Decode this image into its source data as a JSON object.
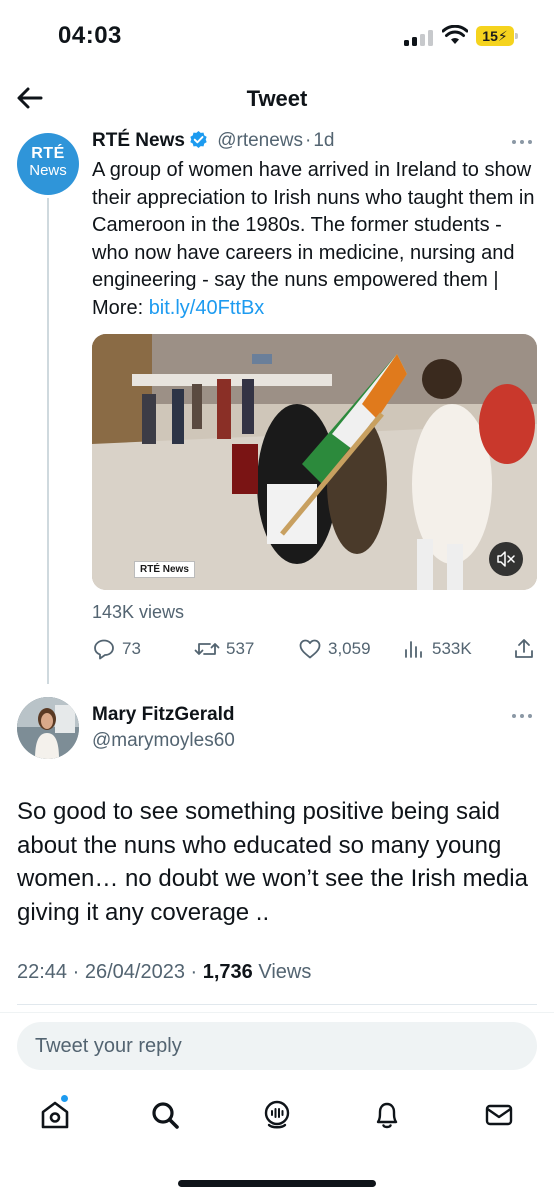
{
  "status_bar": {
    "time": "04:03",
    "battery": "15"
  },
  "header": {
    "title": "Tweet"
  },
  "tweet": {
    "avatar": {
      "line1": "RTÉ",
      "line2": "News"
    },
    "author_name": "RTÉ News",
    "handle": "@rtenews",
    "time": "1d",
    "text": "A group of women have arrived in Ireland to show their appreciation to Irish nuns who taught them in Cameroon in the 1980s. The former students - who now have careers in medicine, nursing and engineering - say the nuns empowered them | More: ",
    "link": "bit.ly/40FttBx",
    "video_logo": "RTÉ News",
    "views": "143K views",
    "actions": {
      "replies": "73",
      "retweets": "537",
      "likes": "3,059",
      "analytics": "533K"
    }
  },
  "reply": {
    "author_name": "Mary FitzGerald",
    "handle": "@marymoyles60",
    "text": "So good to see something positive being said about the nuns who educated so many young women… no doubt we won’t see the Irish media giving it any coverage ..",
    "time": "22:44",
    "date": "26/04/2023",
    "views_count": "1,736",
    "views_label": "Views"
  },
  "reply_box": {
    "placeholder": "Tweet your reply"
  },
  "colors": {
    "accent": "#1d9bf0",
    "muted": "#536471",
    "text": "#0f1419"
  },
  "nav": {
    "items": [
      "home-icon",
      "search-icon",
      "spaces-icon",
      "notifications-icon",
      "messages-icon"
    ]
  }
}
